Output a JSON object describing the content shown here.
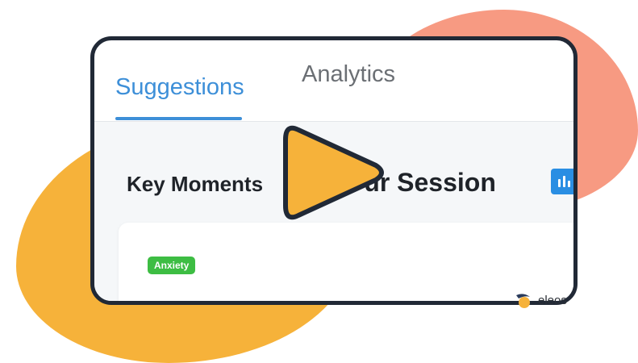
{
  "tabs": [
    {
      "label": "Suggestions",
      "active": true
    },
    {
      "label": "Analytics",
      "active": false
    }
  ],
  "heading": {
    "part1": "Key Moments ",
    "part2": "ur Session"
  },
  "badge": {
    "label": "Anxiety",
    "color": "#3dbd43"
  },
  "brand": {
    "name": "eleos"
  },
  "colors": {
    "accent": "#3d8fd8",
    "play": "#f6b23a",
    "blob_orange": "#f6b23a",
    "blob_salmon": "#f79a82",
    "card_border": "#212936"
  },
  "icons": [
    "play-icon",
    "bars-icon",
    "eleos-logo-icon"
  ]
}
